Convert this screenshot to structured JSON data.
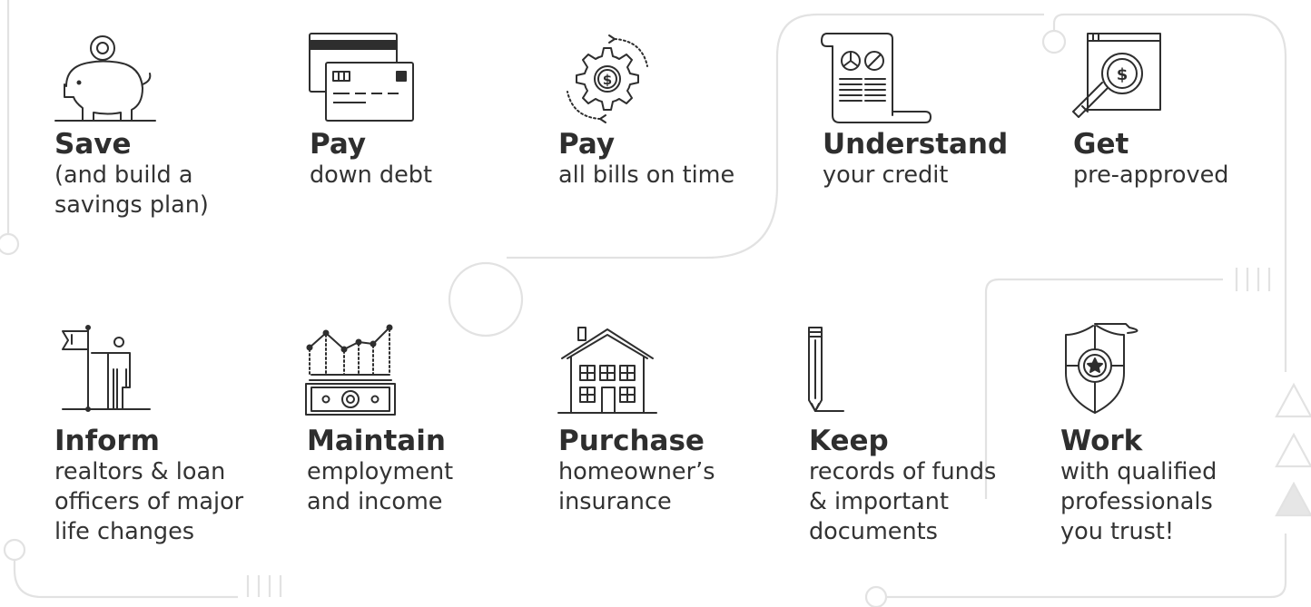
{
  "colors": {
    "ink": "#2e2e2e",
    "decoration": "#e2e2e2"
  },
  "steps": [
    {
      "id": "save",
      "icon": "piggy-bank-icon",
      "title": "Save",
      "lines": [
        "(and build a",
        "savings plan)"
      ]
    },
    {
      "id": "pay-debt",
      "icon": "credit-cards-icon",
      "title": "Pay",
      "lines": [
        "down debt"
      ]
    },
    {
      "id": "pay-bills",
      "icon": "dollar-gear-icon",
      "title": "Pay",
      "lines": [
        "all bills on time"
      ]
    },
    {
      "id": "understand",
      "icon": "credit-report-icon",
      "title": "Understand",
      "lines": [
        "your credit"
      ]
    },
    {
      "id": "get",
      "icon": "magnifier-dollar-icon",
      "title": "Get",
      "lines": [
        "pre-approved"
      ]
    },
    {
      "id": "inform",
      "icon": "person-flag-icon",
      "title": "Inform",
      "lines": [
        "realtors & loan",
        "officers of major",
        "life changes"
      ]
    },
    {
      "id": "maintain",
      "icon": "income-chart-icon",
      "title": "Maintain",
      "lines": [
        "employment",
        "and income"
      ]
    },
    {
      "id": "purchase",
      "icon": "house-icon",
      "title": "Purchase",
      "lines": [
        "homeowner’s",
        "insurance"
      ]
    },
    {
      "id": "keep",
      "icon": "pencil-icon",
      "title": "Keep",
      "lines": [
        "records of funds",
        "& important",
        "documents"
      ]
    },
    {
      "id": "work",
      "icon": "shield-star-icon",
      "title": "Work",
      "lines": [
        "with qualified",
        "professionals",
        "you trust!"
      ]
    }
  ]
}
